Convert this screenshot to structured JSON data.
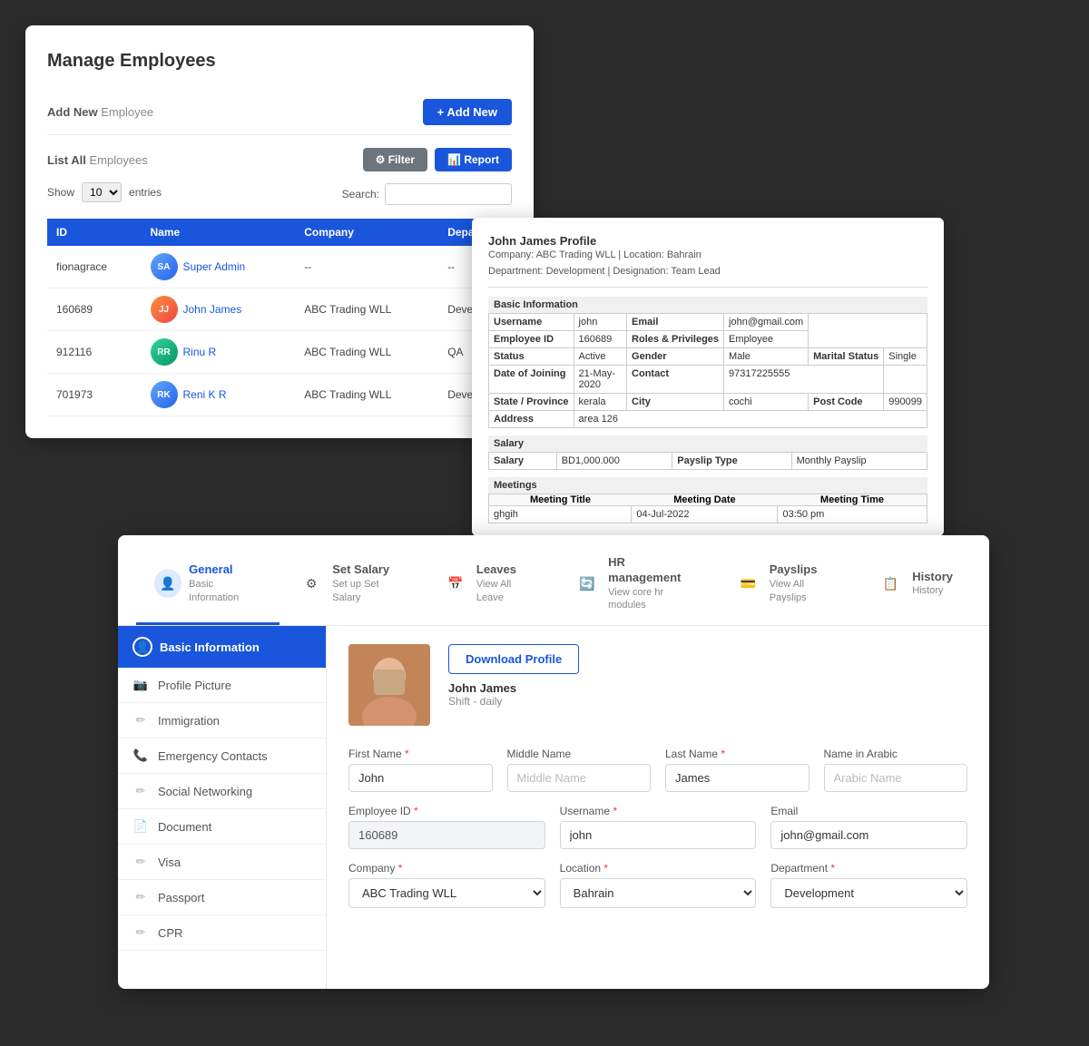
{
  "manage": {
    "title": "Manage Employees",
    "add_label": "Add New",
    "add_label_span": "Employee",
    "add_btn": "+ Add New",
    "list_label": "List All",
    "list_label_span": "Employees",
    "filter_btn": "⚙ Filter",
    "report_btn": "📊 Report",
    "show_label": "Show",
    "show_value": "10",
    "entries_label": "entries",
    "search_label": "Search:",
    "search_placeholder": "",
    "table": {
      "headers": [
        "ID",
        "Name",
        "Company",
        "Depa..."
      ],
      "rows": [
        {
          "id": "fionagrace",
          "name": "Super Admin",
          "company": "--",
          "dept": "--",
          "avatar_initials": "SA",
          "avatar_color": "blue"
        },
        {
          "id": "160689",
          "name": "John James",
          "company": "ABC Trading WLL",
          "dept": "Deve...",
          "avatar_initials": "JJ",
          "avatar_color": "orange"
        },
        {
          "id": "912116",
          "name": "Rinu R",
          "company": "ABC Trading WLL",
          "dept": "QA",
          "avatar_initials": "RR",
          "avatar_color": "teal"
        },
        {
          "id": "701973",
          "name": "Reni K R",
          "company": "ABC Trading WLL",
          "dept": "Deve...",
          "avatar_initials": "RK",
          "avatar_color": "blue"
        }
      ]
    }
  },
  "profile_popup": {
    "name": "John James Profile",
    "meta_line1": "Company: ABC Trading WLL | Location: Bahrain",
    "meta_line2": "Department: Development | Designation: Team Lead",
    "basic_section": "Basic Information",
    "fields": [
      {
        "label": "Username",
        "value": "john"
      },
      {
        "label": "Email",
        "value": "john@gmail.com"
      },
      {
        "label": "Employee ID",
        "value": "160689"
      },
      {
        "label": "Roles & Privileges",
        "value": "Employee"
      },
      {
        "label": "Status",
        "value": "Active"
      },
      {
        "label": "Gender",
        "value": "Male"
      },
      {
        "label": "Marital Status",
        "value": "Single"
      },
      {
        "label": "Date of Joining",
        "value": "21-May-2020"
      },
      {
        "label": "Contact",
        "value": "97317225555"
      },
      {
        "label": "State / Province",
        "value": "kerala"
      },
      {
        "label": "City",
        "value": "cochi"
      },
      {
        "label": "Post Code",
        "value": "990099"
      },
      {
        "label": "Address",
        "value": "area 126"
      }
    ],
    "salary_section": "Salary",
    "salary_value": "BD1,000.000",
    "payslip_label": "Payslip Type",
    "payslip_value": "Monthly Payslip",
    "meetings_section": "Meetings",
    "meeting_headers": [
      "Meeting Title",
      "Meeting Date",
      "Meeting Time"
    ],
    "meetings": [
      {
        "title": "ghgih",
        "date": "04-Jul-2022",
        "time": "03:50 pm"
      }
    ]
  },
  "detail": {
    "nav": [
      {
        "id": "general",
        "icon": "👤",
        "title": "General",
        "sub": "Basic Information",
        "active": true
      },
      {
        "id": "set-salary",
        "icon": "⚙",
        "title": "Set Salary",
        "sub": "Set up Set Salary",
        "active": false
      },
      {
        "id": "leaves",
        "icon": "📅",
        "title": "Leaves",
        "sub": "View All Leave",
        "active": false
      },
      {
        "id": "hr-management",
        "icon": "🔄",
        "title": "HR management",
        "sub": "View core hr modules",
        "active": false
      },
      {
        "id": "payslips",
        "icon": "💳",
        "title": "Payslips",
        "sub": "View All Payslips",
        "active": false
      },
      {
        "id": "history",
        "icon": "📋",
        "title": "History",
        "sub": "History",
        "active": false
      }
    ],
    "sidebar": {
      "section_title": "Basic Information",
      "items": [
        {
          "label": "Profile Picture",
          "icon": "📷"
        },
        {
          "label": "Immigration",
          "icon": "✏"
        },
        {
          "label": "Emergency Contacts",
          "icon": "📞"
        },
        {
          "label": "Social Networking",
          "icon": "✏"
        },
        {
          "label": "Document",
          "icon": "📄"
        },
        {
          "label": "Visa",
          "icon": "✏"
        },
        {
          "label": "Passport",
          "icon": "✏"
        },
        {
          "label": "CPR",
          "icon": "✏"
        }
      ]
    },
    "employee": {
      "download_btn": "Download Profile",
      "name": "John James",
      "shift": "Shift - daily"
    },
    "form": {
      "first_name_label": "First Name",
      "first_name_value": "John",
      "middle_name_label": "Middle Name",
      "middle_name_placeholder": "Middle Name",
      "last_name_label": "Last Name",
      "last_name_value": "James",
      "arabic_name_label": "Name in Arabic",
      "arabic_name_placeholder": "Arabic Name",
      "employee_id_label": "Employee ID",
      "employee_id_value": "160689",
      "username_label": "Username",
      "username_value": "john",
      "email_label": "Email",
      "email_value": "john@gmail.com",
      "company_label": "Company",
      "company_value": "ABC Trading WLL",
      "location_label": "Location",
      "location_value": "Bahrain",
      "department_label": "Department",
      "department_value": "Development"
    }
  }
}
